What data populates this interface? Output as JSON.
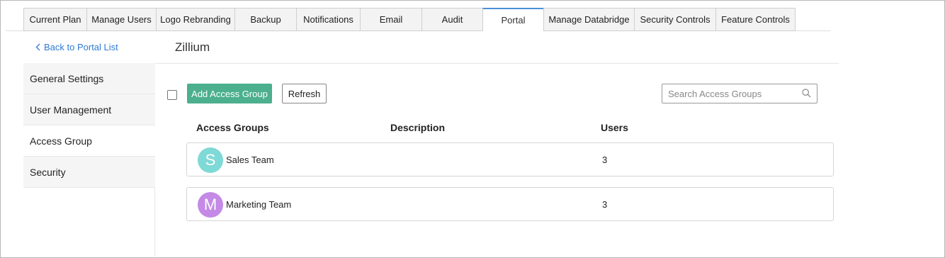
{
  "tabs": [
    {
      "label": "Current Plan",
      "active": false
    },
    {
      "label": "Manage Users",
      "active": false
    },
    {
      "label": "Logo Rebranding",
      "active": false
    },
    {
      "label": "Backup",
      "active": false
    },
    {
      "label": "Notifications",
      "active": false
    },
    {
      "label": "Email",
      "active": false
    },
    {
      "label": "Audit",
      "active": false
    },
    {
      "label": "Portal",
      "active": true
    },
    {
      "label": "Manage Databridge",
      "active": false
    },
    {
      "label": "Security Controls",
      "active": false
    },
    {
      "label": "Feature Controls",
      "active": false
    }
  ],
  "header": {
    "back_link": "Back to Portal List",
    "portal_name": "Zillium"
  },
  "sidebar": {
    "items": [
      {
        "label": "General Settings",
        "active": false
      },
      {
        "label": "User Management",
        "active": false
      },
      {
        "label": "Access Group",
        "active": true
      },
      {
        "label": "Security",
        "active": false
      }
    ]
  },
  "toolbar": {
    "add_label": "Add Access Group",
    "refresh_label": "Refresh",
    "search_placeholder": "Search Access Groups",
    "search_value": ""
  },
  "table": {
    "columns": [
      "Access Groups",
      "Description",
      "Users"
    ],
    "rows": [
      {
        "initial": "S",
        "name": "Sales Team",
        "description": "",
        "users": "3",
        "avatar_color": "#7fd9d6"
      },
      {
        "initial": "M",
        "name": "Marketing Team",
        "description": "",
        "users": "3",
        "avatar_color": "#c48ae6"
      }
    ]
  },
  "colors": {
    "accent": "#4caf8e",
    "link": "#2f7bd1",
    "active_tab_border": "#4a90d9"
  }
}
